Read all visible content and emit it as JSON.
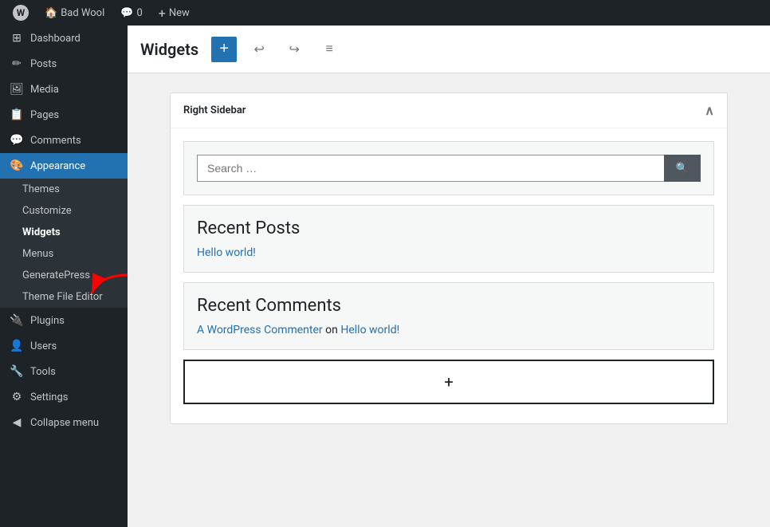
{
  "admin_bar": {
    "wp_logo": "W",
    "site_name": "Bad Wool",
    "comments_icon": "💬",
    "comments_count": "0",
    "new_label": "+ New",
    "new_dropdown_label": "New"
  },
  "sidebar": {
    "items": [
      {
        "id": "dashboard",
        "label": "Dashboard",
        "icon": "⊞"
      },
      {
        "id": "posts",
        "label": "Posts",
        "icon": "📄"
      },
      {
        "id": "media",
        "label": "Media",
        "icon": "🖼"
      },
      {
        "id": "pages",
        "label": "Pages",
        "icon": "📋"
      },
      {
        "id": "comments",
        "label": "Comments",
        "icon": "💬"
      },
      {
        "id": "appearance",
        "label": "Appearance",
        "icon": "🎨",
        "active": true
      }
    ],
    "appearance_submenu": [
      {
        "id": "themes",
        "label": "Themes"
      },
      {
        "id": "customize",
        "label": "Customize"
      },
      {
        "id": "widgets",
        "label": "Widgets",
        "active": true
      },
      {
        "id": "menus",
        "label": "Menus"
      },
      {
        "id": "generatepress",
        "label": "GeneratePress"
      },
      {
        "id": "theme-file-editor",
        "label": "Theme File Editor"
      }
    ],
    "bottom_items": [
      {
        "id": "plugins",
        "label": "Plugins",
        "icon": "🔌"
      },
      {
        "id": "users",
        "label": "Users",
        "icon": "👤"
      },
      {
        "id": "tools",
        "label": "Tools",
        "icon": "🔧"
      },
      {
        "id": "settings",
        "label": "Settings",
        "icon": "⚙"
      },
      {
        "id": "collapse",
        "label": "Collapse menu",
        "icon": "◀"
      }
    ]
  },
  "header": {
    "title": "Widgets",
    "add_button_label": "+",
    "undo_icon": "↩",
    "redo_icon": "↪",
    "options_icon": "≡"
  },
  "right_sidebar": {
    "title": "Right Sidebar"
  },
  "search_widget": {
    "placeholder": "Search …",
    "button_icon": "🔍"
  },
  "recent_posts": {
    "title": "Recent Posts",
    "posts": [
      {
        "title": "Hello world!",
        "url": "#"
      }
    ]
  },
  "recent_comments": {
    "title": "Recent Comments",
    "comments": [
      {
        "author": "A WordPress Commenter",
        "on_text": "on",
        "post": "Hello world!"
      }
    ]
  },
  "add_block": {
    "label": "+"
  }
}
